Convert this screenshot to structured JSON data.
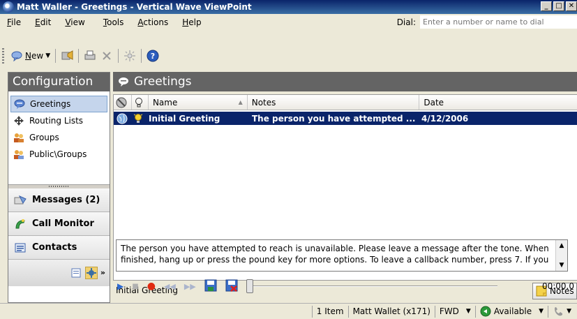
{
  "window": {
    "title": "Matt Waller - Greetings - Vertical Wave ViewPoint"
  },
  "menu": [
    {
      "key": "F",
      "rest": "ile"
    },
    {
      "key": "E",
      "rest": "dit"
    },
    {
      "key": "V",
      "rest": "iew"
    },
    {
      "key": "T",
      "rest": "ools"
    },
    {
      "key": "A",
      "rest": "ctions"
    },
    {
      "key": "H",
      "rest": "elp"
    }
  ],
  "dial": {
    "label": "Dial:",
    "placeholder": "Enter a number or name to dial"
  },
  "toolbar": {
    "new_key": "N",
    "new_rest": "ew"
  },
  "left_panel": {
    "header": "Configuration",
    "items": [
      "Greetings",
      "Routing Lists",
      "Groups",
      "Public\\Groups"
    ],
    "messages": "Messages (2)",
    "call_monitor": "Call Monitor",
    "contacts": "Contacts"
  },
  "main": {
    "header": "Greetings",
    "columns": [
      "Name",
      "Notes",
      "Date"
    ],
    "rows": [
      {
        "name": "Initial Greeting",
        "notes": "The person you have attempted ...",
        "date": "4/12/2006"
      }
    ],
    "preview_title": "Initial Greeting",
    "notes_button": "Notes",
    "preview_text": "The person you have attempted to reach is unavailable. Please leave a message after the tone. When finished, hang up or press the pound key for more options. To leave a callback number, press 7. If you",
    "time": "00:00.0"
  },
  "status": {
    "items_count": "1 Item",
    "user": "Matt Wallet (x171)",
    "mode": "FWD",
    "presence": "Available"
  },
  "colors": {
    "header_gray": "#646464",
    "selection": "#0a246a",
    "title_bar": "#0a246a"
  }
}
